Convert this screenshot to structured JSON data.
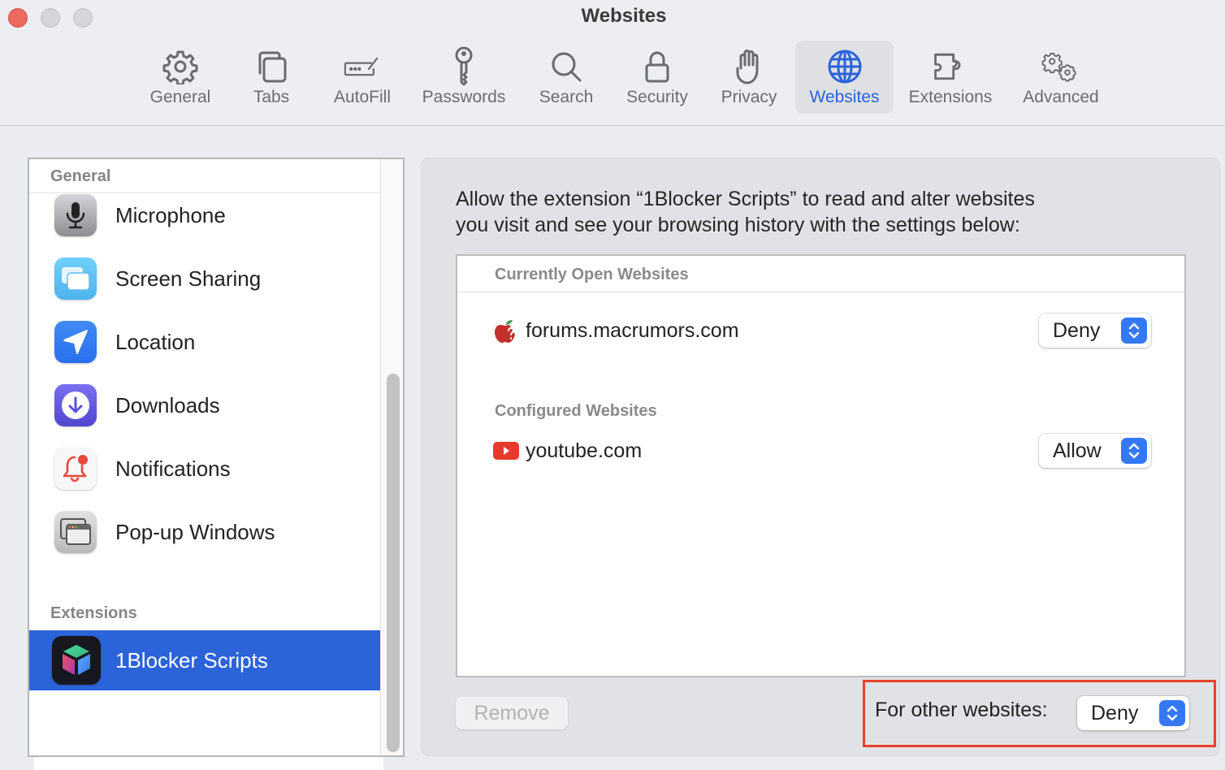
{
  "window": {
    "title": "Websites",
    "controls": [
      "close",
      "minimize",
      "zoom"
    ]
  },
  "toolbar": {
    "tabs": [
      {
        "label": "General",
        "icon": "gear-icon",
        "active": false
      },
      {
        "label": "Tabs",
        "icon": "tabs-icon",
        "active": false
      },
      {
        "label": "AutoFill",
        "icon": "autofill-icon",
        "active": false
      },
      {
        "label": "Passwords",
        "icon": "key-icon",
        "active": false
      },
      {
        "label": "Search",
        "icon": "search-icon",
        "active": false
      },
      {
        "label": "Security",
        "icon": "lock-icon",
        "active": false
      },
      {
        "label": "Privacy",
        "icon": "hand-icon",
        "active": false
      },
      {
        "label": "Websites",
        "icon": "globe-icon",
        "active": true
      },
      {
        "label": "Extensions",
        "icon": "puzzle-icon",
        "active": false
      },
      {
        "label": "Advanced",
        "icon": "gears-icon",
        "active": false
      }
    ],
    "accent_color": "#2a64da"
  },
  "sidebar": {
    "sections": [
      {
        "header": "General",
        "items": [
          {
            "label": "Microphone",
            "icon": "microphone-icon"
          },
          {
            "label": "Screen Sharing",
            "icon": "screen-sharing-icon"
          },
          {
            "label": "Location",
            "icon": "location-icon"
          },
          {
            "label": "Downloads",
            "icon": "downloads-icon"
          },
          {
            "label": "Notifications",
            "icon": "notifications-icon"
          },
          {
            "label": "Pop-up Windows",
            "icon": "popup-windows-icon"
          }
        ]
      },
      {
        "header": "Extensions",
        "items": [
          {
            "label": "1Blocker Scripts",
            "icon": "1blocker-icon",
            "selected": true
          }
        ]
      }
    ],
    "selection_color": "#2b63d9"
  },
  "main": {
    "description": "Allow the extension “1Blocker Scripts” to read and alter websites you visit and see your browsing history with the settings below:",
    "description_line1": "Allow the extension “1Blocker Scripts” to read and alter websites",
    "description_line2": "you visit and see your browsing history with the settings below:",
    "groups": [
      {
        "header": "Currently Open Websites",
        "sites": [
          {
            "name": "forums.macrumors.com",
            "favicon": "macrumors-icon",
            "permission": "Deny"
          }
        ]
      },
      {
        "header": "Configured Websites",
        "sites": [
          {
            "name": "youtube.com",
            "favicon": "youtube-icon",
            "permission": "Allow"
          }
        ]
      }
    ],
    "remove_label": "Remove",
    "remove_enabled": false,
    "other_websites_label": "For other websites:",
    "other_websites_value": "Deny",
    "highlight_color": "#e8432e"
  }
}
